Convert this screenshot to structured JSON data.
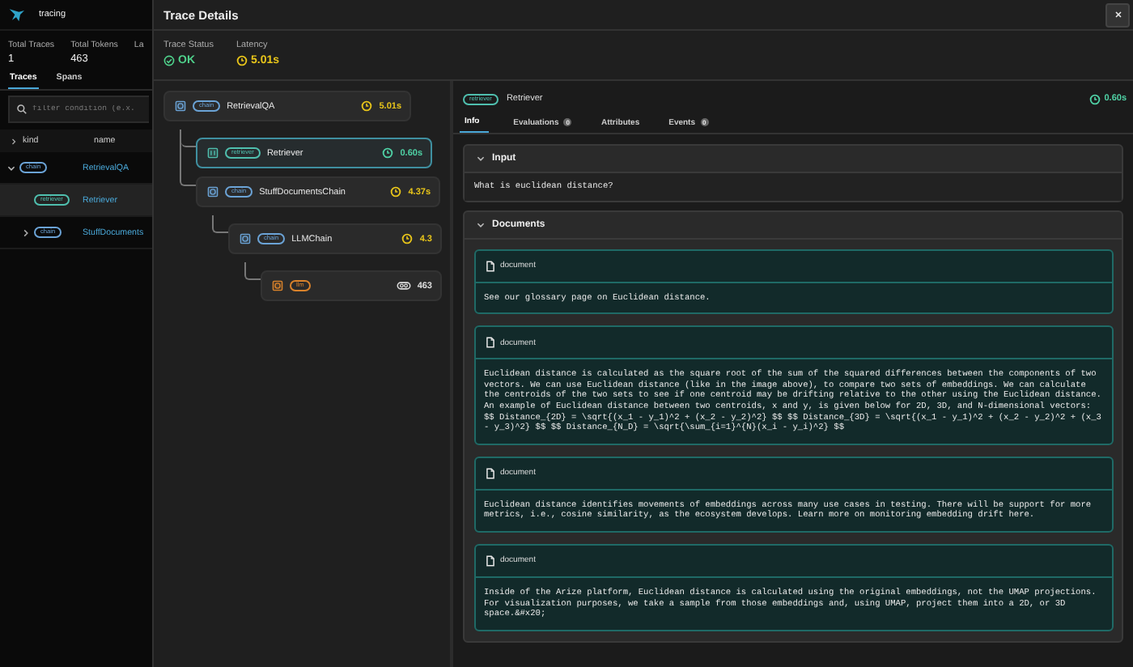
{
  "app": {
    "title": "tracing",
    "stats": [
      {
        "label": "Total Traces",
        "value": "1"
      },
      {
        "label": "Total Tokens",
        "value": "463"
      },
      {
        "label": "La"
      }
    ],
    "tabs": [
      {
        "label": "Traces",
        "selected": true
      },
      {
        "label": "Spans",
        "selected": false
      }
    ],
    "filter": {
      "placeholder": "filter condition (e.x."
    },
    "table": {
      "columns": [
        "kind",
        "name"
      ],
      "rows": [
        {
          "kind": "chain",
          "name": "RetrievalQA",
          "expanded": true,
          "selected": false,
          "children": [
            {
              "kind": "retriever",
              "name": "Retriever",
              "selected": true
            },
            {
              "kind": "chain",
              "name": "StuffDocuments",
              "expanded": false,
              "selected": false
            }
          ]
        }
      ]
    }
  },
  "drawer": {
    "title": "Trace Details",
    "status": {
      "label": "Trace Status",
      "value": "OK"
    },
    "latency": {
      "label": "Latency",
      "value": "5.01s"
    },
    "tree": [
      {
        "kind": "chain",
        "name": "RetrievalQA",
        "latency": "5.01s",
        "color": "#e8c51a",
        "selected": false,
        "children": [
          {
            "kind": "retriever",
            "name": "Retriever",
            "latency": "0.60s",
            "color": "#4fd1a5",
            "selected": true
          },
          {
            "kind": "chain",
            "name": "StuffDocumentsChain",
            "latency": "4.37s",
            "color": "#e8c51a",
            "selected": false,
            "children": [
              {
                "kind": "chain",
                "name": "LLMChain",
                "latency": "4.3",
                "color": "#e8c51a",
                "selected": false,
                "children": [
                  {
                    "kind": "llm",
                    "tokens": "463",
                    "selected": false
                  }
                ]
              }
            ]
          }
        ]
      }
    ],
    "span": {
      "kind": "retriever",
      "name": "Retriever",
      "latency": "0.60s",
      "tabs": [
        {
          "label": "Info",
          "selected": true
        },
        {
          "label": "Evaluations",
          "count": "0",
          "selected": false
        },
        {
          "label": "Attributes",
          "selected": false
        },
        {
          "label": "Events",
          "count": "0",
          "selected": false
        }
      ],
      "sections": [
        {
          "kind": "text",
          "title": "Input",
          "expanded": true,
          "text": "What is euclidean distance?"
        },
        {
          "kind": "documents",
          "title": "Documents",
          "expanded": true,
          "documents": [
            {
              "label": "document",
              "content": "See our glossary page on Euclidean distance."
            },
            {
              "label": "document",
              "content": "Euclidean distance is calculated as the square root of the sum of the squared differences between the components of two vectors. We can use Euclidean distance (like in the image above), to compare two sets of embeddings. We can calculate the centroids of the two sets to see if one centroid may be drifting relative to the other using the Euclidean distance. An example of Euclidean distance between two centroids, x and y, is given below for 2D, 3D, and N-dimensional vectors: $$ Distance_{2D} = \\sqrt{(x_1 - y_1)^2 + (x_2 - y_2)^2} $$ $$ Distance_{3D} = \\sqrt{(x_1 - y_1)^2 + (x_2 - y_2)^2 + (x_3 - y_3)^2} $$ $$ Distance_{N_D} = \\sqrt{\\sum_{i=1}^{N}(x_i - y_i)^2} $$"
            },
            {
              "label": "document",
              "content": "Euclidean distance identifies movements of embeddings across many use cases in testing. There will be support for more metrics, i.e., cosine similarity, as the ecosystem develops. Learn more on monitoring embedding drift here."
            },
            {
              "label": "document",
              "content": "Inside of the Arize platform, Euclidean distance is calculated using the original embeddings, not the UMAP projections. For visualization purposes, we take a sample from those embeddings and, using UMAP, project them into a 2D, or 3D space.&#x20;"
            }
          ]
        }
      ]
    }
  }
}
